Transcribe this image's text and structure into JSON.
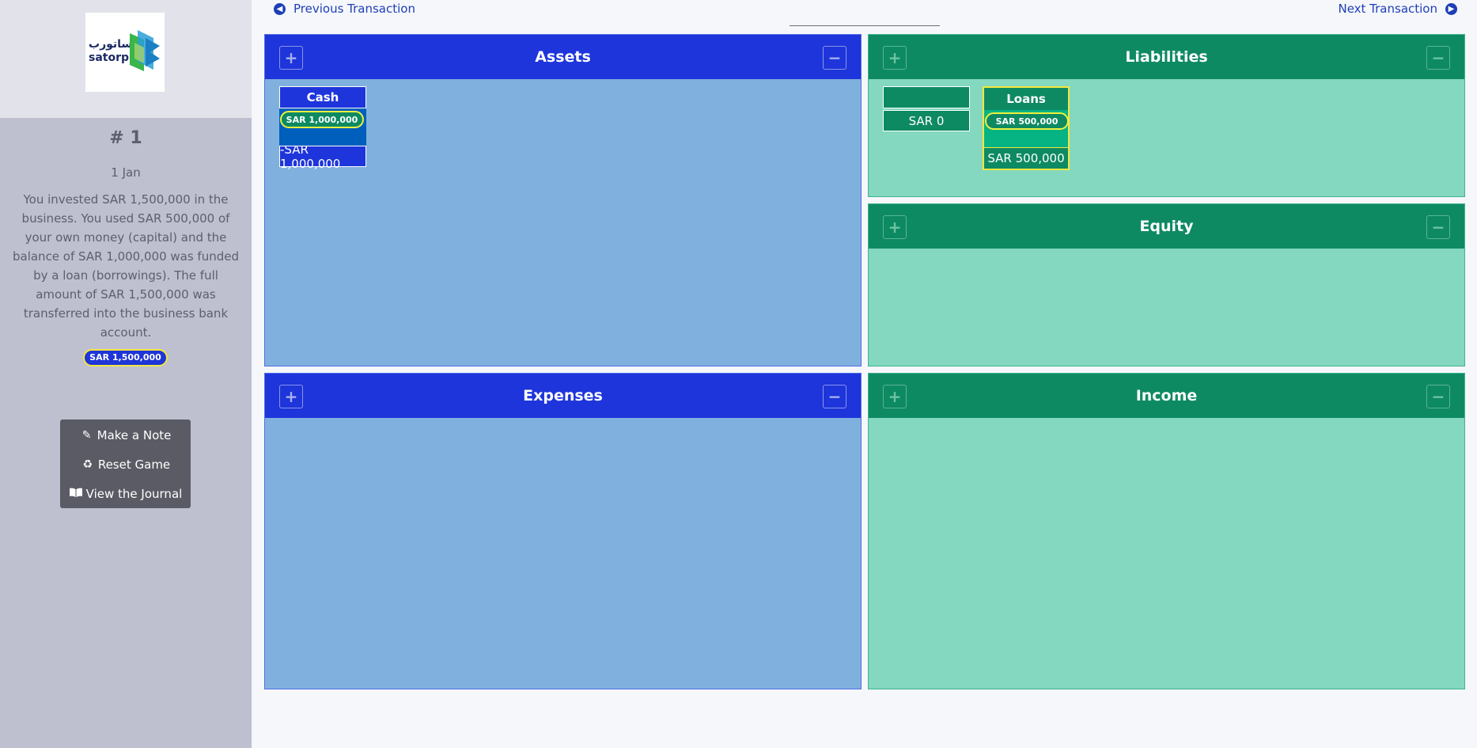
{
  "sidebar": {
    "logo": {
      "arabic": "ساتورب",
      "latin": "satorp"
    },
    "transaction": {
      "number": "# 1",
      "date": "1 Jan",
      "description": "You invested SAR 1,500,000 in the business. You used SAR 500,000 of your own money (capital) and the balance of SAR 1,000,000 was funded by a loan (borrowings). The full amount of SAR 1,500,000 was transferred into the business bank account.",
      "amount": "SAR 1,500,000"
    },
    "menu": [
      {
        "label": "Make a Note",
        "icon": "pencil-icon"
      },
      {
        "label": "Reset Game",
        "icon": "recycle-icon"
      },
      {
        "label": "View the Journal",
        "icon": "book-icon"
      }
    ]
  },
  "nav": {
    "previous": "Previous Transaction",
    "next": "Next Transaction"
  },
  "panels": {
    "assets": {
      "title": "Assets"
    },
    "liabilities": {
      "title": "Liabilities"
    },
    "equity": {
      "title": "Equity"
    },
    "expenses": {
      "title": "Expenses"
    },
    "income": {
      "title": "Income"
    }
  },
  "buttons": {
    "plus": "+",
    "minus": "−"
  },
  "accounts": {
    "cash": {
      "name": "Cash",
      "chip": "SAR 1,000,000",
      "total": "-SAR 1,000,000"
    },
    "blank": {
      "name": "",
      "total": "SAR 0"
    },
    "loans": {
      "name": "Loans",
      "chip": "SAR 500,000",
      "total": "SAR 500,000"
    }
  },
  "colors": {
    "blue_header": "#1e35db",
    "blue_panel": "#80b1de",
    "green_header": "#0e8a62",
    "green_panel": "#83d8bf",
    "highlight": "#f4e640"
  }
}
